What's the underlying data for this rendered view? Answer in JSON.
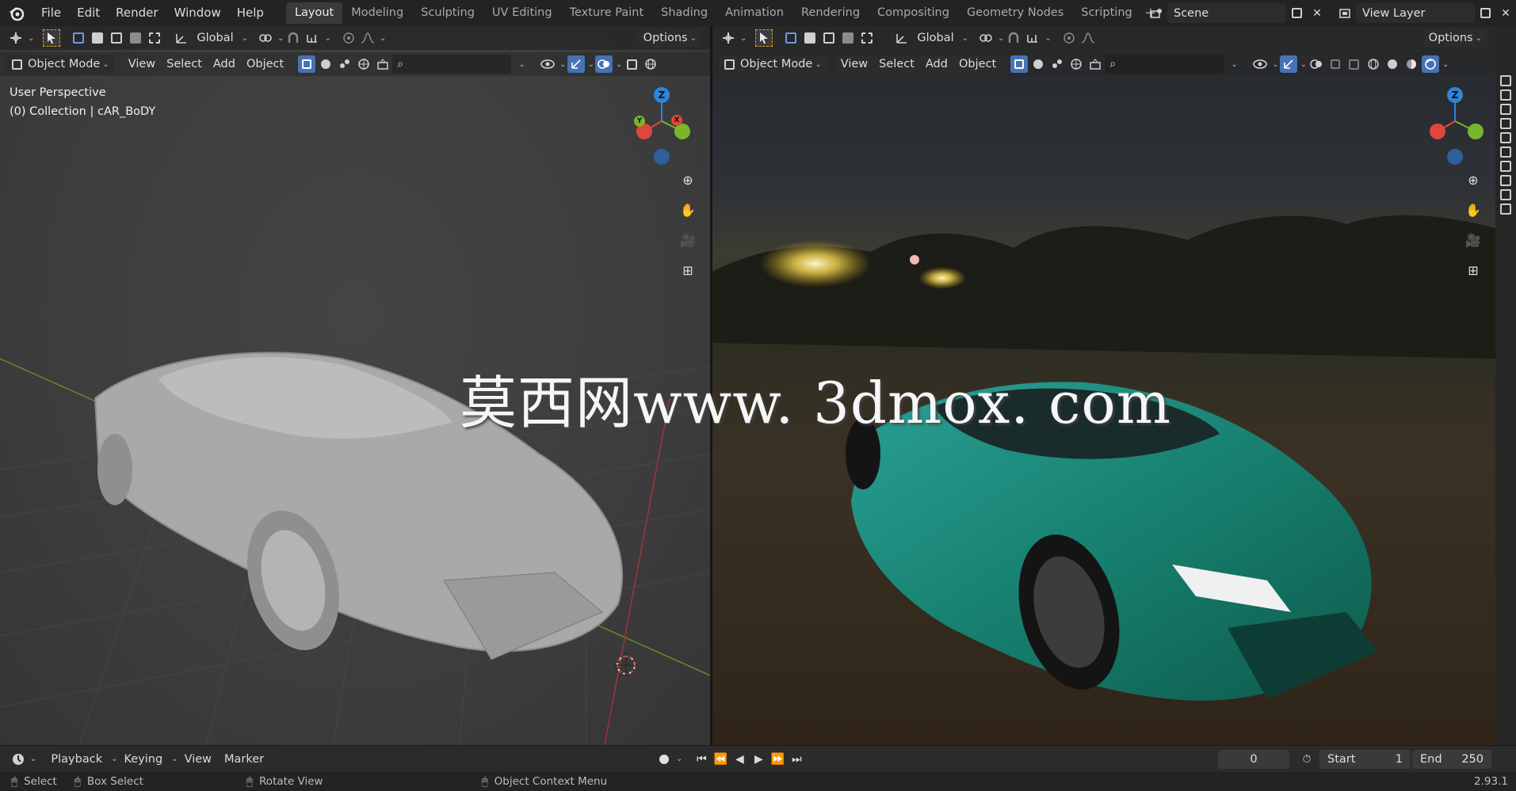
{
  "topbar": {
    "menu": [
      "File",
      "Edit",
      "Render",
      "Window",
      "Help"
    ],
    "workspace_tabs": [
      "Layout",
      "Modeling",
      "Sculpting",
      "UV Editing",
      "Texture Paint",
      "Shading",
      "Animation",
      "Rendering",
      "Compositing",
      "Geometry Nodes",
      "Scripting"
    ],
    "active_tab": "Layout",
    "scene_name": "Scene",
    "view_layer": "View Layer"
  },
  "viewport_left": {
    "orientation": "Global",
    "options_label": "Options",
    "mode": "Object Mode",
    "menu": [
      "View",
      "Select",
      "Add",
      "Object"
    ],
    "perspective_label": "User Perspective",
    "collection_label": "(0) Collection | cAR_BoDY",
    "shading": "solid"
  },
  "viewport_right": {
    "orientation": "Global",
    "options_label": "Options",
    "mode": "Object Mode",
    "menu": [
      "View",
      "Select",
      "Add",
      "Object"
    ],
    "shading": "rendered"
  },
  "gizmo": {
    "z": "Z",
    "y": "Y",
    "x": "X"
  },
  "watermark": "莫西网www. 3dmox. com",
  "timeline": {
    "playback": "Playback",
    "keying": "Keying",
    "view": "View",
    "marker": "Marker",
    "current_frame": "0",
    "start_label": "Start",
    "start_value": "1",
    "end_label": "End",
    "end_value": "250"
  },
  "statusbar": {
    "select": "Select",
    "box_select": "Box Select",
    "rotate_view": "Rotate View",
    "context_menu": "Object Context Menu",
    "version": "2.93.1"
  },
  "colors": {
    "accent_blue": "#4772b3",
    "axis_x": "#e0463c",
    "axis_y": "#7ab52c",
    "axis_z": "#2e86d6",
    "car_paint": "#1a8a7e"
  }
}
